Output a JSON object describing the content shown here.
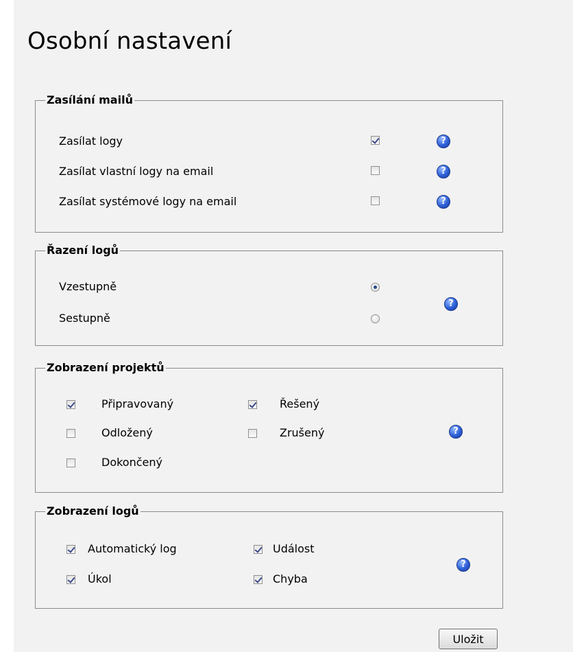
{
  "page": {
    "title": "Osobní nastavení"
  },
  "mail_section": {
    "legend": "Zasílání mailů",
    "items": [
      {
        "label": "Zasílat logy",
        "checked": true
      },
      {
        "label": "Zasílat vlastní logy na email",
        "checked": false
      },
      {
        "label": "Zasílat systémové logy na email",
        "checked": false
      }
    ]
  },
  "sort_section": {
    "legend": "Řazení logů",
    "options": [
      {
        "label": "Vzestupně",
        "selected": true
      },
      {
        "label": "Sestupně",
        "selected": false
      }
    ]
  },
  "projects_section": {
    "legend": "Zobrazení projektů",
    "items": [
      {
        "label": "Připravovaný",
        "checked": true
      },
      {
        "label": "Řešený",
        "checked": true
      },
      {
        "label": "Odložený",
        "checked": false
      },
      {
        "label": "Zrušený",
        "checked": false
      },
      {
        "label": "Dokončený",
        "checked": false
      }
    ]
  },
  "logs_section": {
    "legend": "Zobrazení logů",
    "items": [
      {
        "label": "Automatický log",
        "checked": true
      },
      {
        "label": "Událost",
        "checked": true
      },
      {
        "label": "Úkol",
        "checked": true
      },
      {
        "label": "Chyba",
        "checked": true
      }
    ]
  },
  "help": {
    "symbol": "?",
    "icon": "help-icon",
    "color": "#2d5fd6"
  },
  "actions": {
    "save_label": "Uložit"
  }
}
